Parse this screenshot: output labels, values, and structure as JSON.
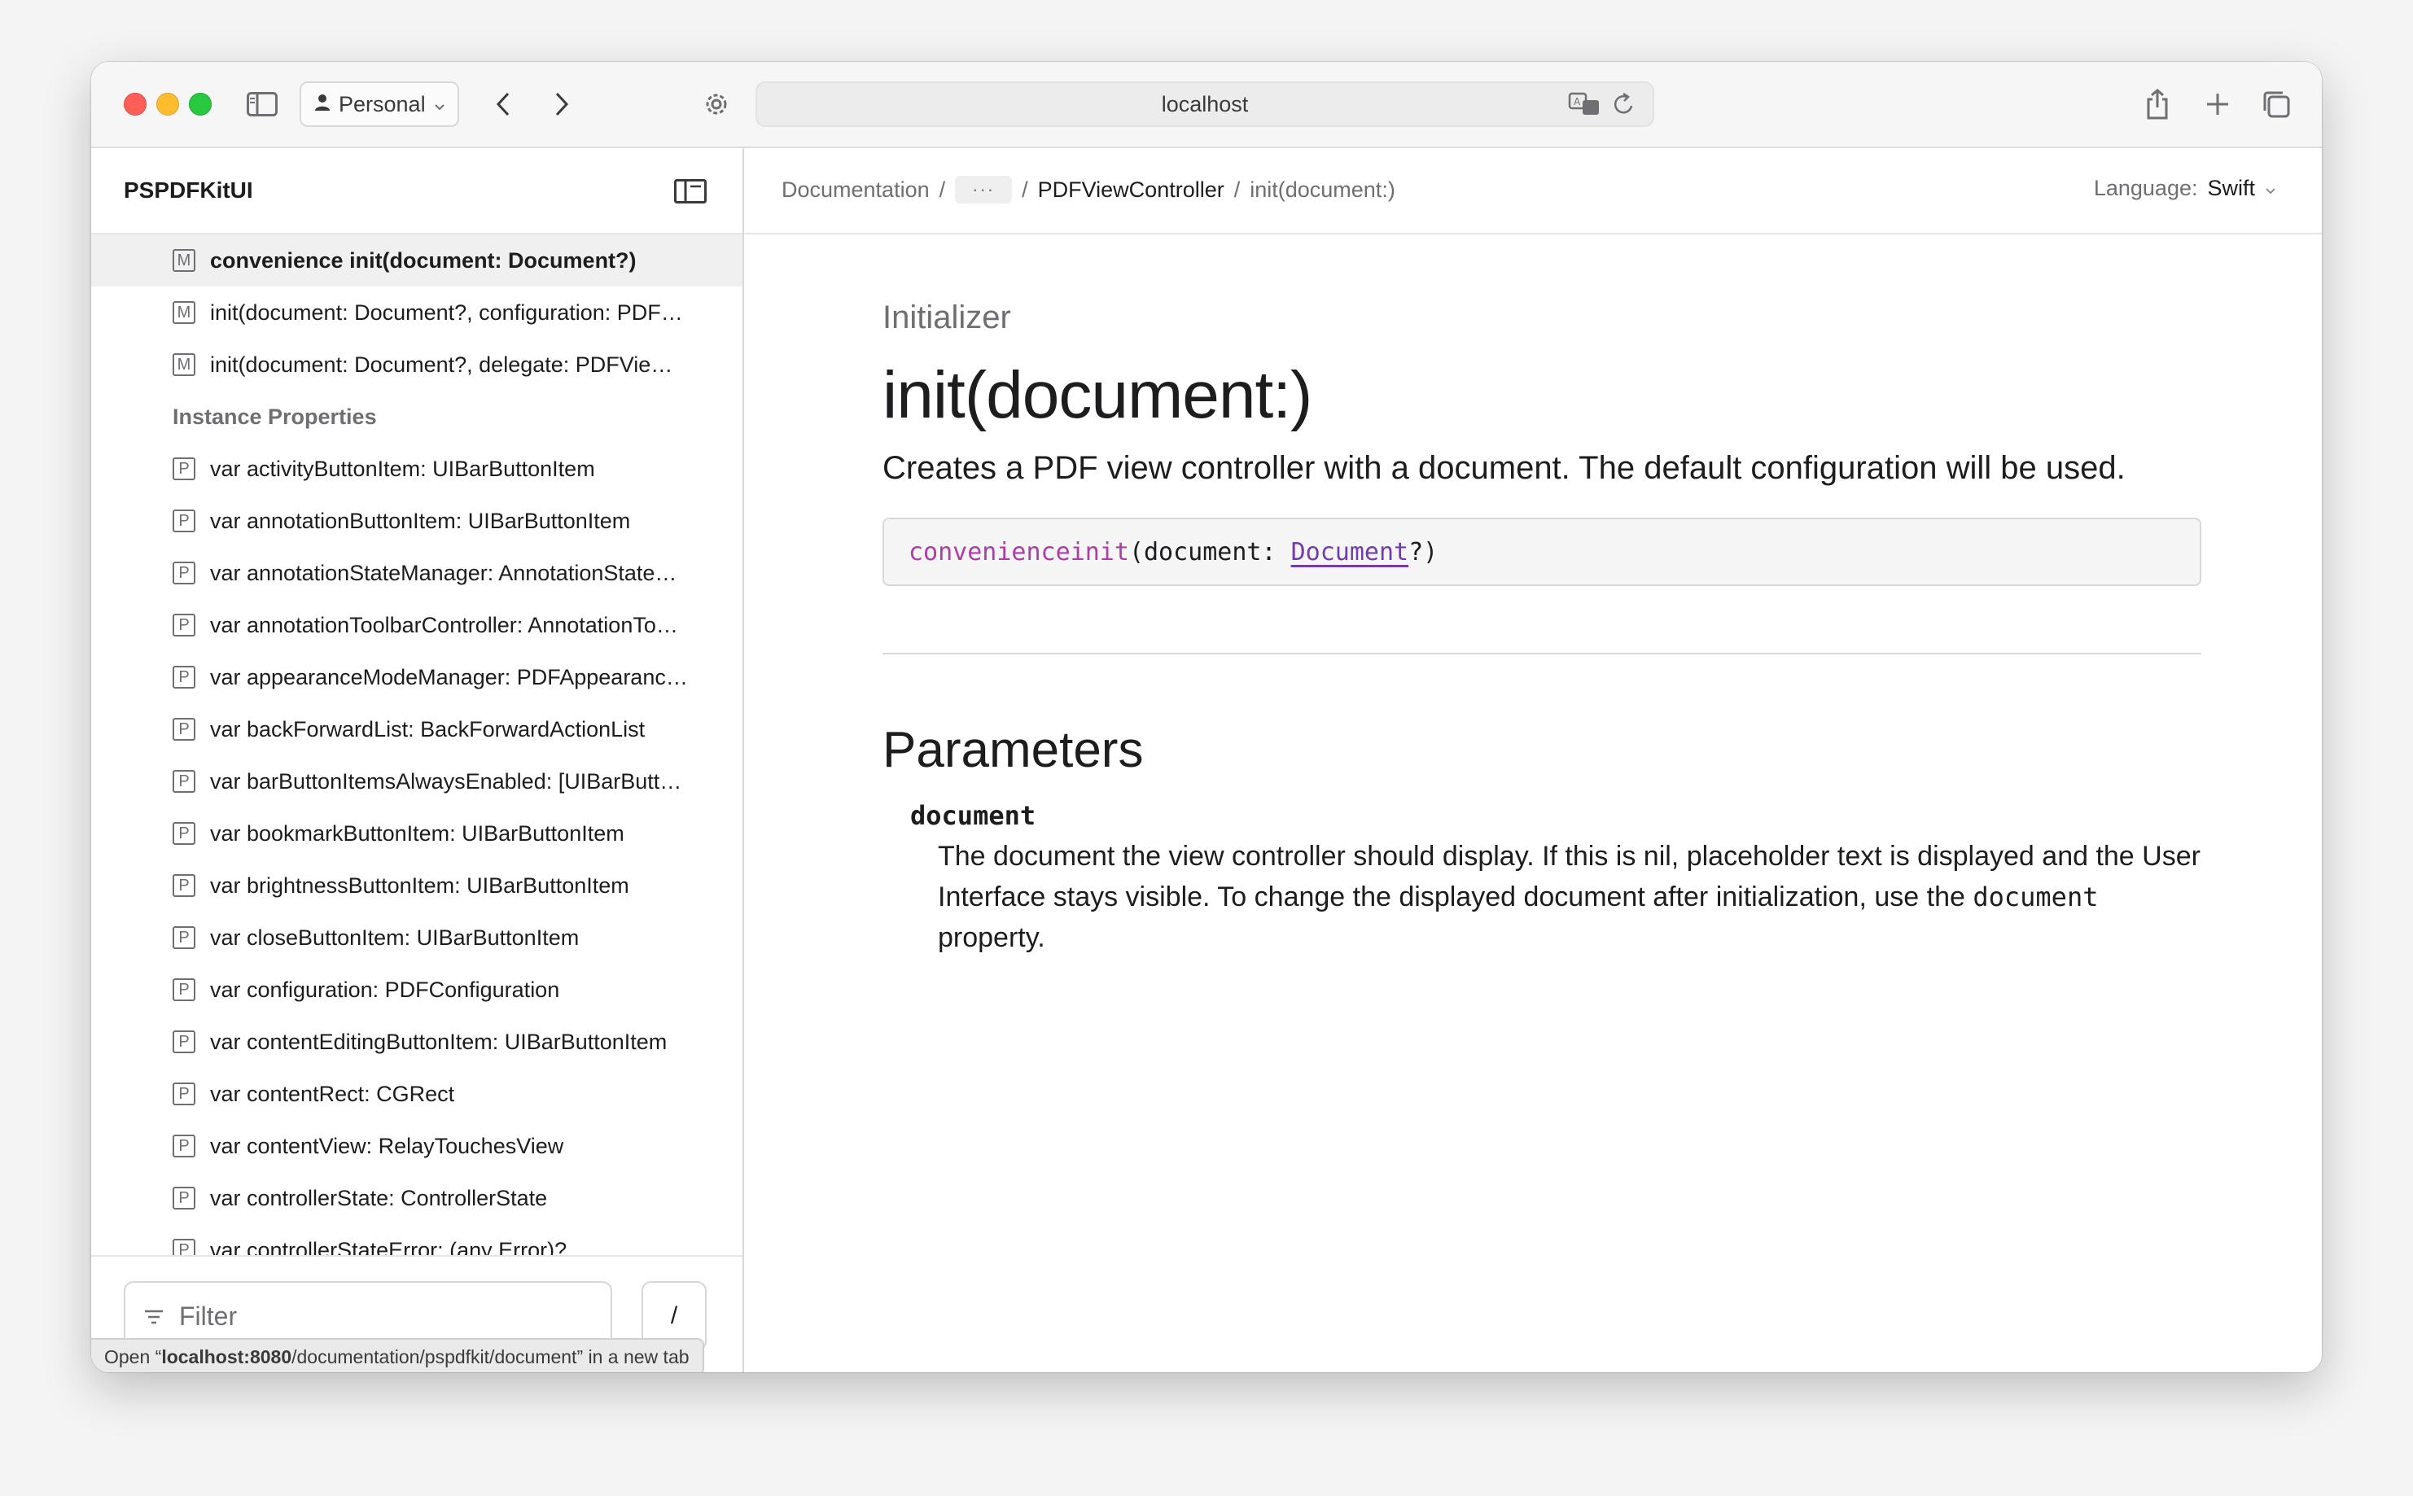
{
  "browser": {
    "profile_label": "Personal",
    "address": "localhost"
  },
  "sidebar": {
    "title": "PSPDFKitUI",
    "items_top": [
      {
        "badge": "M",
        "label": "convenience init(document: Document?)",
        "active": true
      },
      {
        "badge": "M",
        "label": "init(document: Document?, configuration: PDF…"
      },
      {
        "badge": "M",
        "label": "init(document: Document?, delegate: PDFVie…"
      }
    ],
    "section_title": "Instance Properties",
    "items": [
      {
        "badge": "P",
        "label": "var activityButtonItem: UIBarButtonItem"
      },
      {
        "badge": "P",
        "label": "var annotationButtonItem: UIBarButtonItem"
      },
      {
        "badge": "P",
        "label": "var annotationStateManager: AnnotationState…"
      },
      {
        "badge": "P",
        "label": "var annotationToolbarController: AnnotationTo…"
      },
      {
        "badge": "P",
        "label": "var appearanceModeManager: PDFAppearanc…"
      },
      {
        "badge": "P",
        "label": "var backForwardList: BackForwardActionList"
      },
      {
        "badge": "P",
        "label": "var barButtonItemsAlwaysEnabled: [UIBarButt…"
      },
      {
        "badge": "P",
        "label": "var bookmarkButtonItem: UIBarButtonItem"
      },
      {
        "badge": "P",
        "label": "var brightnessButtonItem: UIBarButtonItem"
      },
      {
        "badge": "P",
        "label": "var closeButtonItem: UIBarButtonItem"
      },
      {
        "badge": "P",
        "label": "var configuration: PDFConfiguration"
      },
      {
        "badge": "P",
        "label": "var contentEditingButtonItem: UIBarButtonItem"
      },
      {
        "badge": "P",
        "label": "var contentRect: CGRect"
      },
      {
        "badge": "P",
        "label": "var contentView: RelayTouchesView"
      },
      {
        "badge": "P",
        "label": "var controllerState: ControllerState"
      },
      {
        "badge": "P",
        "label": "var controllerStateError: (any Error)?"
      }
    ],
    "filter_placeholder": "Filter",
    "filter_shortcut": "/"
  },
  "status_bar": {
    "text_prefix": "Open “",
    "text_strong": "localhost:8080",
    "text_path": "/documentation/pspdfkit/document",
    "text_suffix": "” in a new tab"
  },
  "breadcrumbs": {
    "root": "Documentation",
    "sep": "/",
    "more": "···",
    "parent": "PDFViewController",
    "current": "init(document:)"
  },
  "language": {
    "label": "Language:",
    "value": "Swift"
  },
  "doc": {
    "kind": "Initializer",
    "title": "init(document:)",
    "abstract": "Creates a PDF view controller with a document. The default configuration will be used.",
    "declaration": {
      "keyword1": "convenience",
      "keyword2": "init",
      "open": "(document: ",
      "type": "Document",
      "close": "?)"
    },
    "parameters_title": "Parameters",
    "param_name": "document",
    "param_desc_1": "The document the view controller should display. If this is nil, placeholder text is displayed and the User Interface stays visible. To change the displayed document after initialization, use the ",
    "param_desc_code": "document",
    "param_desc_2": " property."
  }
}
